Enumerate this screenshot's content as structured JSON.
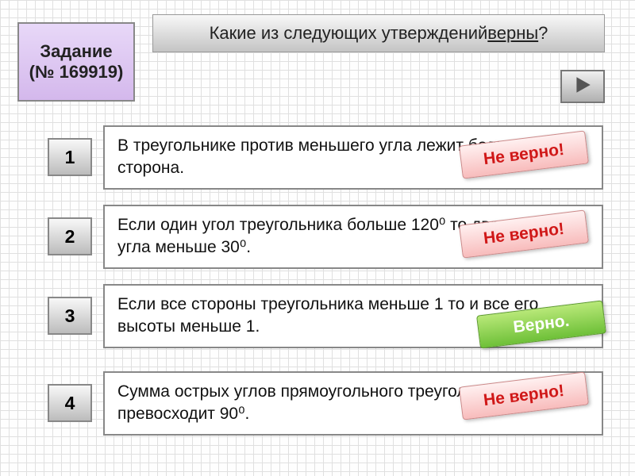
{
  "task": {
    "title": "Задание",
    "number": "(№ 169919)"
  },
  "question": {
    "prefix": "Какие из следующих утверждений ",
    "emph": "верны",
    "suffix": "?"
  },
  "statements": [
    {
      "num": "1",
      "text": "В треугольнике против меньшего угла лежит большая сторона.",
      "verdict": "Не верно!",
      "correct": false
    },
    {
      "num": "2",
      "text": "Если один угол треугольника больше 120⁰ то два других его угла меньше 30⁰.",
      "verdict": "Не верно!",
      "correct": false
    },
    {
      "num": "3",
      "text": "Если все стороны треугольника меньше 1 то и все его высоты меньше 1.",
      "verdict": "Верно.",
      "correct": true
    },
    {
      "num": "4",
      "text": "Сумма острых углов прямоугольного треугольника не превосходит 90⁰.",
      "verdict": "Не верно!",
      "correct": false
    }
  ],
  "icons": {
    "next": "play-triangle-icon"
  }
}
